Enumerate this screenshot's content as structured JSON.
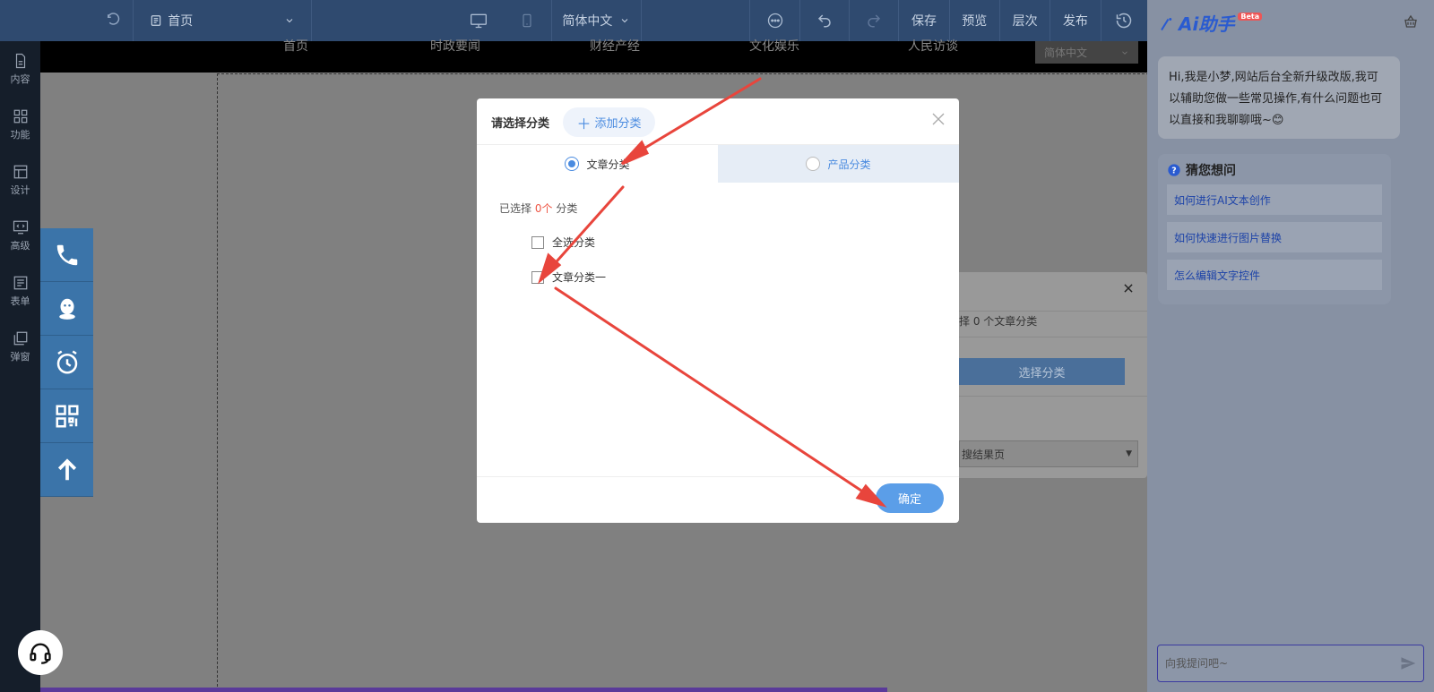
{
  "topbar": {
    "page_name": "首页",
    "language": "简体中文",
    "actions": [
      "保存",
      "预览",
      "层次",
      "发布"
    ]
  },
  "leftbar": {
    "items": [
      {
        "label": "内容",
        "icon": "file-icon"
      },
      {
        "label": "功能",
        "icon": "grid-icon"
      },
      {
        "label": "设计",
        "icon": "layout-icon"
      },
      {
        "label": "高级",
        "icon": "code-monitor-icon"
      },
      {
        "label": "表单",
        "icon": "form-icon"
      },
      {
        "label": "弹窗",
        "icon": "popup-icon"
      }
    ]
  },
  "site": {
    "nav": [
      "首页",
      "时政要闻",
      "财经产经",
      "文化娱乐",
      "人民访谈"
    ],
    "lang_select": "简体中文"
  },
  "floatbar": {
    "items": [
      "phone-icon",
      "qq-icon",
      "alarm-icon",
      "qrcode-icon",
      "arrow-up-icon"
    ]
  },
  "background_panel": {
    "count_text": "择 0 个文章分类",
    "select_button": "选择分类",
    "result_select": "搜结果页"
  },
  "modal": {
    "title": "请选择分类",
    "add_button": "添加分类",
    "tabs": [
      {
        "label": "文章分类",
        "checked": true
      },
      {
        "label": "产品分类",
        "checked": false
      }
    ],
    "selected_prefix": "已选择",
    "selected_count": "0个",
    "selected_suffix": "分类",
    "checkboxes": [
      {
        "label": "全选分类",
        "checked": false
      },
      {
        "label": "文章分类一",
        "checked": false
      }
    ],
    "confirm_button": "确定"
  },
  "assistant": {
    "logo_text": "Ai助手",
    "beta": "Beta",
    "greeting": "Hi,我是小梦,网站后台全新升级改版,我可以辅助您做一些常见操作,有什么问题也可以直接和我聊聊哦~😊",
    "guess_title": "猜您想问",
    "questions": [
      "如何进行AI文本创作",
      "如何快速进行图片替换",
      "怎么编辑文字控件"
    ],
    "input_placeholder": "向我提问吧~"
  },
  "colors": {
    "accent": "#4a8be0",
    "annotation_arrow": "#e8453c",
    "topbar": "#2f4a6f"
  }
}
